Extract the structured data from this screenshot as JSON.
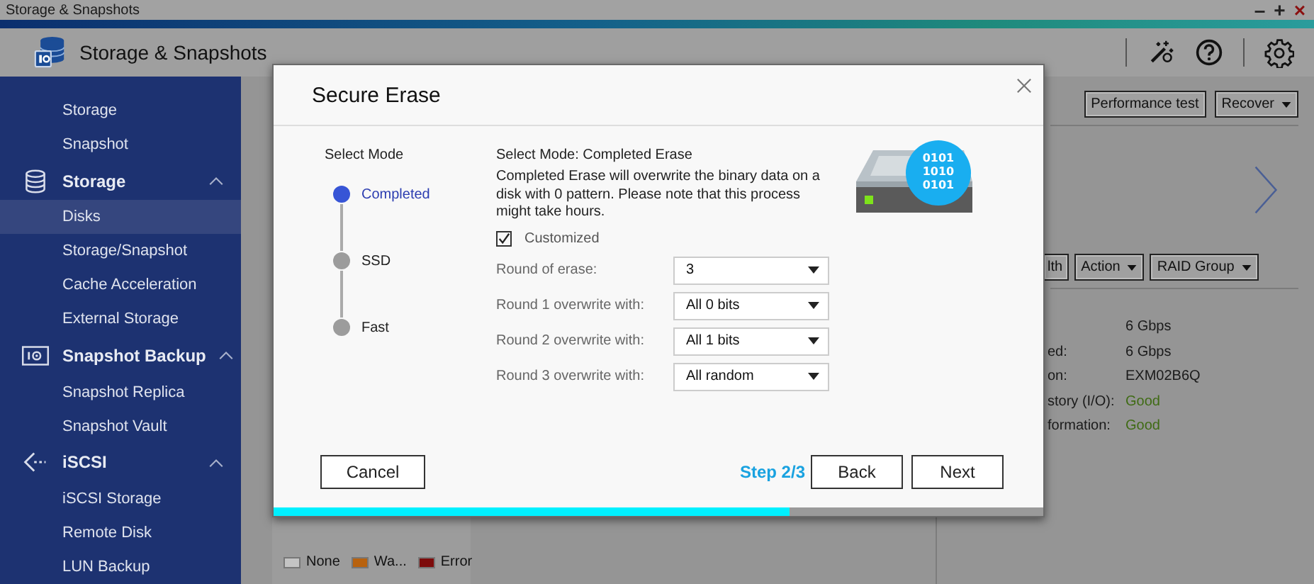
{
  "title_bar": {
    "title": "Storage & Snapshots",
    "controls": [
      "–",
      "+",
      "×"
    ]
  },
  "header": {
    "title": "Storage & Snapshots"
  },
  "sidebar": {
    "sections": [
      {
        "children": [
          {
            "label": "Storage",
            "selected": false
          },
          {
            "label": "Snapshot",
            "selected": false
          }
        ]
      },
      {
        "label": "Storage",
        "expanded": true,
        "children": [
          {
            "label": "Disks",
            "selected": true
          },
          {
            "label": "Storage/Snapshot",
            "selected": false
          },
          {
            "label": "Cache Acceleration",
            "selected": false
          },
          {
            "label": "External Storage",
            "selected": false
          }
        ]
      },
      {
        "label": "Snapshot Backup",
        "expanded": true,
        "children": [
          {
            "label": "Snapshot Replica",
            "selected": false
          },
          {
            "label": "Snapshot Vault",
            "selected": false
          }
        ]
      },
      {
        "label": "iSCSI",
        "expanded": true,
        "children": [
          {
            "label": "iSCSI Storage",
            "selected": false
          },
          {
            "label": "Remote Disk",
            "selected": false
          },
          {
            "label": "LUN Backup",
            "selected": false
          }
        ]
      }
    ]
  },
  "top_toolbar": [
    {
      "label": "Performance test",
      "dropdown": false
    },
    {
      "label": "Recover",
      "dropdown": true
    }
  ],
  "disk_toolbar": [
    {
      "label": "lth",
      "dropdown": false
    },
    {
      "label": "Action",
      "dropdown": true
    },
    {
      "label": "RAID Group",
      "dropdown": true
    }
  ],
  "details": [
    {
      "value": "6 Gbps"
    },
    {
      "label": "ed:",
      "value": "6 Gbps"
    },
    {
      "label": "on:",
      "value": "EXM02B6Q"
    },
    {
      "label": "story (I/O):",
      "value": "Good",
      "color": "#3f6b14"
    },
    {
      "label": "formation:",
      "value": "Good",
      "color": "#3f6b14"
    }
  ],
  "legend": [
    {
      "label": "None",
      "color": "#c4c4c4"
    },
    {
      "label": "Wa...",
      "color": "#b8620f"
    },
    {
      "label": "Error",
      "color": "#7d0c0c"
    }
  ],
  "dialog": {
    "title": "Secure Erase",
    "modes_heading": "Select Mode",
    "modes": [
      {
        "label": "Completed",
        "selected": true
      },
      {
        "label": "SSD",
        "selected": false
      },
      {
        "label": "Fast",
        "selected": false
      }
    ],
    "heading": "Select Mode: Completed Erase",
    "description": "Completed Erase will overwrite the binary data on a disk with 0 pattern. Please note that this process might take hours.",
    "customized": {
      "label": "Customized",
      "checked": true
    },
    "fields": [
      {
        "label": "Round of erase:",
        "value": "3"
      },
      {
        "label": "Round 1 overwrite with:",
        "value": "All 0 bits"
      },
      {
        "label": "Round 2 overwrite with:",
        "value": "All 1 bits"
      },
      {
        "label": "Round 3 overwrite with:",
        "value": "All random"
      }
    ],
    "illustration_text": [
      "0101",
      "1010",
      "0101"
    ],
    "cancel": "Cancel",
    "step": "Step 2/3",
    "buttons": [
      "Back",
      "Next"
    ],
    "progress": {
      "level": 0.67
    }
  }
}
